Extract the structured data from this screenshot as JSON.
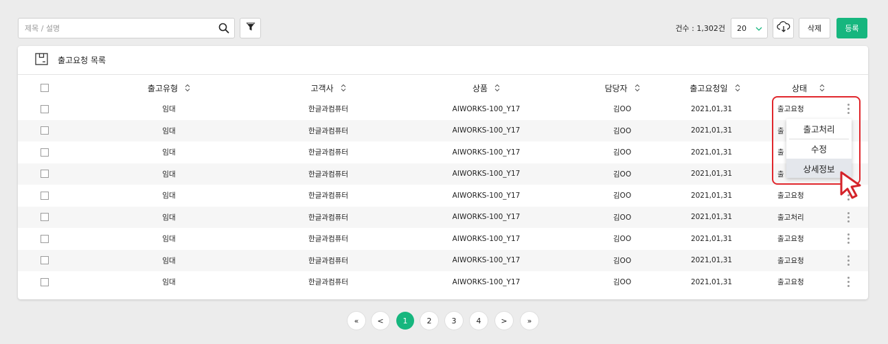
{
  "toolbar": {
    "search_placeholder": "제목 / 설명",
    "count_label": "건수 : 1,302건",
    "page_size": "20",
    "delete_label": "삭제",
    "register_label": "등록"
  },
  "card": {
    "title": "출고요청 목록"
  },
  "table": {
    "columns": [
      "출고유형",
      "고객사",
      "상품",
      "담당자",
      "출고요청일",
      "상태"
    ],
    "rows": [
      [
        "임대",
        "한글과컴퓨터",
        "AIWORKS-100_Y17",
        "김OO",
        "2021,01,31",
        "출고요청"
      ],
      [
        "임대",
        "한글과컴퓨터",
        "AIWORKS-100_Y17",
        "김OO",
        "2021,01,31",
        "출"
      ],
      [
        "임대",
        "한글과컴퓨터",
        "AIWORKS-100_Y17",
        "김OO",
        "2021,01,31",
        "출"
      ],
      [
        "임대",
        "한글과컴퓨터",
        "AIWORKS-100_Y17",
        "김OO",
        "2021,01,31",
        "출"
      ],
      [
        "임대",
        "한글과컴퓨터",
        "AIWORKS-100_Y17",
        "김OO",
        "2021,01,31",
        "출고요청"
      ],
      [
        "임대",
        "한글과컴퓨터",
        "AIWORKS-100_Y17",
        "김OO",
        "2021,01,31",
        "출고처리"
      ],
      [
        "임대",
        "한글과컴퓨터",
        "AIWORKS-100_Y17",
        "김OO",
        "2021,01,31",
        "출고요청"
      ],
      [
        "임대",
        "한글과컴퓨터",
        "AIWORKS-100_Y17",
        "김OO",
        "2021,01,31",
        "출고요청"
      ],
      [
        "임대",
        "한글과컴퓨터",
        "AIWORKS-100_Y17",
        "김OO",
        "2021,01,31",
        "출고요청"
      ]
    ]
  },
  "dropdown": {
    "items": [
      "출고처리",
      "수정",
      "상세정보"
    ],
    "active_index": 2
  },
  "pagination": {
    "first": "«",
    "prev": "<",
    "pages": [
      "1",
      "2",
      "3",
      "4"
    ],
    "current": "1",
    "next": ">",
    "last": "»"
  },
  "colors": {
    "accent": "#16b67e",
    "highlight": "#e0262b"
  }
}
